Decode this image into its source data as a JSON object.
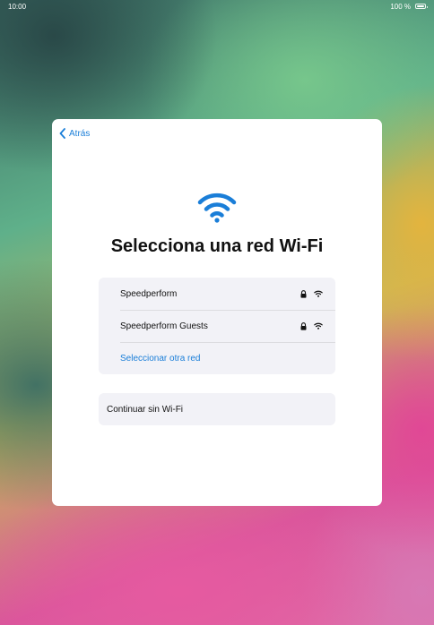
{
  "status_bar": {
    "time": "10:00",
    "battery_percent": "100 %"
  },
  "header": {
    "back_label": "Atrás"
  },
  "main": {
    "title": "Selecciona una red Wi-Fi",
    "networks": [
      {
        "name": "Speedperform",
        "locked": true,
        "icon": "wifi-icon"
      },
      {
        "name": "Speedperform Guests",
        "locked": true,
        "icon": "wifi-icon"
      }
    ],
    "other_network_label": "Seleccionar otra red",
    "continue_label": "Continuar sin Wi-Fi"
  },
  "colors": {
    "accent": "#1a7ed8",
    "card": "#ffffff",
    "list_bg": "#f2f2f7"
  }
}
